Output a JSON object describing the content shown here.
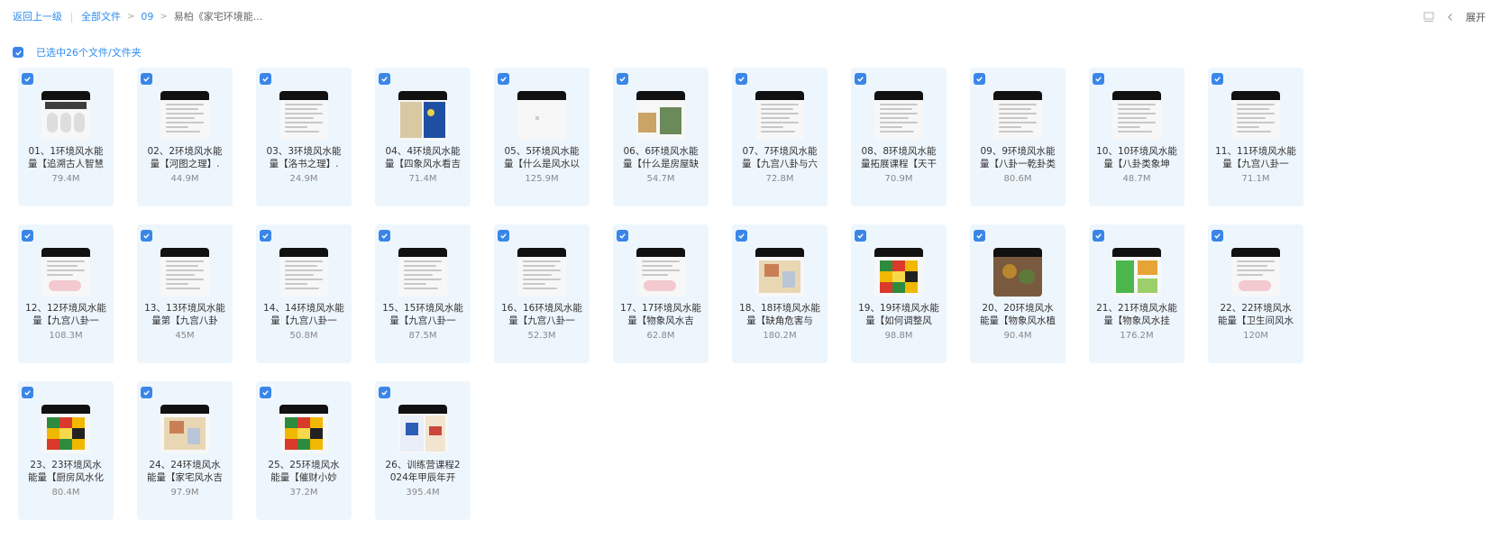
{
  "breadcrumb": {
    "back": "返回上一级",
    "all_files": "全部文件",
    "folder": "09",
    "current": "易柏《家宅环境能..."
  },
  "toolbar": {
    "expand_label": "展开"
  },
  "selection": {
    "text": "已选中26个文件/文件夹"
  },
  "colors": {
    "accent": "#2d8cf0",
    "card_bg": "#eef6fd",
    "checkbox": "#3a86e8"
  },
  "files": [
    {
      "line1": "01、1环境风水能",
      "line2": "量【追溯古人智慧",
      "size": "79.4M",
      "style": "red"
    },
    {
      "line1": "02、2环境风水能",
      "line2": "量【河图之理】.",
      "size": "44.9M",
      "style": "text"
    },
    {
      "line1": "03、3环境风水能",
      "line2": "量【洛书之理】.",
      "size": "24.9M",
      "style": "text"
    },
    {
      "line1": "04、4环境风水能",
      "line2": "量【四象风水看吉",
      "size": "71.4M",
      "style": "blue"
    },
    {
      "line1": "05、5环境风水能",
      "line2": "量【什么是风水以",
      "size": "125.9M",
      "style": "white"
    },
    {
      "line1": "06、6环境风水能",
      "line2": "量【什么是房屋缺",
      "size": "54.7M",
      "style": "photo"
    },
    {
      "line1": "07、7环境风水能",
      "line2": "量【九宫八卦与六",
      "size": "72.8M",
      "style": "text"
    },
    {
      "line1": "08、8环境风水能",
      "line2": "量拓展课程【天干",
      "size": "70.9M",
      "style": "text"
    },
    {
      "line1": "09、9环境风水能",
      "line2": "量【八卦一乾卦类",
      "size": "80.6M",
      "style": "text"
    },
    {
      "line1": "10、10环境风水能",
      "line2": "量【八卦类象坤",
      "size": "48.7M",
      "style": "text"
    },
    {
      "line1": "11、11环境风水能",
      "line2": "量【九宫八卦一",
      "size": "71.1M",
      "style": "text"
    },
    {
      "line1": "12、12环境风水能",
      "line2": "量【九宫八卦一",
      "size": "108.3M",
      "style": "pink"
    },
    {
      "line1": "13、13环境风水能",
      "line2": "量第【九宫八卦",
      "size": "45M",
      "style": "text"
    },
    {
      "line1": "14、14环境风水能",
      "line2": "量【九宫八卦一",
      "size": "50.8M",
      "style": "text"
    },
    {
      "line1": "15、15环境风水能",
      "line2": "量【九宫八卦一",
      "size": "87.5M",
      "style": "text"
    },
    {
      "line1": "16、16环境风水能",
      "line2": "量【九宫八卦一",
      "size": "52.3M",
      "style": "text"
    },
    {
      "line1": "17、17环境风水能",
      "line2": "量【物象风水吉",
      "size": "62.8M",
      "style": "pink"
    },
    {
      "line1": "18、18环境风水能",
      "line2": "量【缺角危害与",
      "size": "180.2M",
      "style": "plan"
    },
    {
      "line1": "19、19环境风水能",
      "line2": "量【如何调整风",
      "size": "98.8M",
      "style": "color"
    },
    {
      "line1": "20、20环境风水",
      "line2": "能量【物象风水植",
      "size": "90.4M",
      "style": "plant"
    },
    {
      "line1": "21、21环境风水能",
      "line2": "量【物象风水挂",
      "size": "176.2M",
      "style": "green"
    },
    {
      "line1": "22、22环境风水",
      "line2": "能量【卫生间风水",
      "size": "120M",
      "style": "pink"
    },
    {
      "line1": "23、23环境风水",
      "line2": "能量【厨房风水化",
      "size": "80.4M",
      "style": "color"
    },
    {
      "line1": "24、24环境风水",
      "line2": "能量【家宅风水吉",
      "size": "97.9M",
      "style": "plan"
    },
    {
      "line1": "25、25环境风水",
      "line2": "能量【催财小妙",
      "size": "37.2M",
      "style": "color"
    },
    {
      "line1": "26、训练营课程2",
      "line2": "024年甲辰年开",
      "size": "395.4M",
      "style": "poster"
    }
  ]
}
